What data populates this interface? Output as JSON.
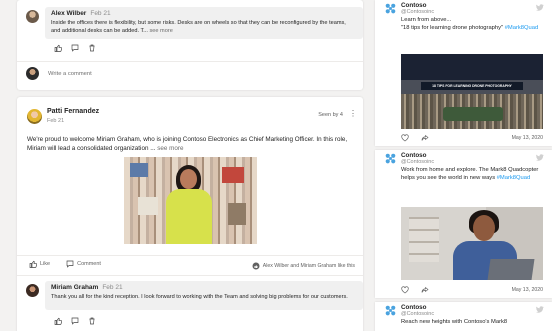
{
  "feed": {
    "comment1": {
      "author": "Alex Wilber",
      "date": "Feb 21",
      "text": "Inside the offices there is flexibility, but some risks. Desks are on wheels so that they can be reconfigured by the teams, and additional desks can be added. T... ",
      "see_more": "see more"
    },
    "write_comment_placeholder": "Write a comment",
    "post": {
      "author": "Patti Fernandez",
      "date": "Feb 21",
      "seen_by": "Seen by 4",
      "text": "We're proud to welcome Miriam Graham, who is joining Contoso Electronics as Chief Marketing Officer. In this role, Miriam will lead a consolidated organization ... ",
      "see_more": "see more",
      "like_label": "Like",
      "comment_label": "Comment",
      "liked_by": "Alex Wilber and Miriam Graham like this"
    },
    "comment2": {
      "author": "Miriam Graham",
      "date": "Feb 21",
      "text": "Thank you all for the kind reception. I look forward to working with the Team and solving big problems for our customers."
    }
  },
  "twitter": {
    "tweets": [
      {
        "name": "Contoso",
        "handle": "@Contosoinc",
        "text_1": "Learn from above... ",
        "text_2": "\"18 tips for learning drone photography\" ",
        "hashtag": "#Mark8Quad",
        "image_caption": "18 TIPS FOR LEARNING DRONE PHOTOGRAPHY",
        "date": "May 13, 2020"
      },
      {
        "name": "Contoso",
        "handle": "@Contosoinc",
        "text_1": "Work from home and explore. The Mark8 Quadcopter helps you see the world in new ways ",
        "hashtag": "#Mark8Quad",
        "date": "May 13, 2020"
      },
      {
        "name": "Contoso",
        "handle": "@Contosoinc",
        "text_1": "Reach new heights with Contoso's Mark8"
      }
    ]
  },
  "colors": {
    "hashtag": "#1d9bf0",
    "brand_logo": "#4aa3df",
    "card_bg": "#ffffff",
    "page_bg": "#f3f2f1"
  },
  "icons": {
    "like": "thumbs-up-icon",
    "reply": "chat-icon",
    "delete": "trash-icon",
    "more": "more-options-icon",
    "tweet_like": "heart-icon",
    "tweet_share": "share-icon",
    "twitter": "twitter-bird-icon",
    "brand": "contoso-logo-icon"
  }
}
